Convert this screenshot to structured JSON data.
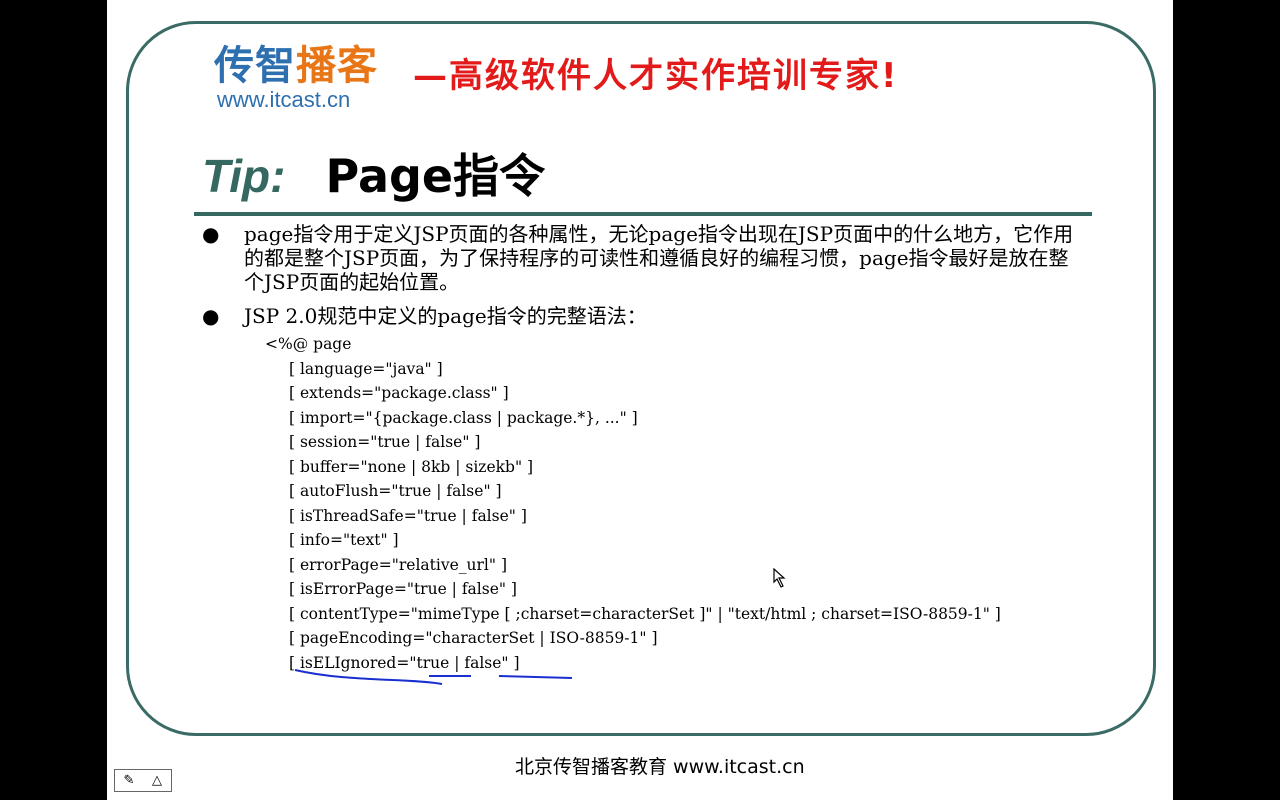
{
  "logo": {
    "name_part1": "传智",
    "name_part2": "播客",
    "url": "www.itcast.cn"
  },
  "slogan": "—高级软件人才实作培训专家!",
  "title": {
    "tip": "Tip:",
    "main": "Page指令"
  },
  "bullets": [
    "page指令用于定义JSP页面的各种属性，无论page指令出现在JSP页面中的什么地方，它作用的都是整个JSP页面，为了保持程序的可读性和遵循良好的编程习惯，page指令最好是放在整个JSP页面的起始位置。",
    "JSP 2.0规范中定义的page指令的完整语法："
  ],
  "code": {
    "open": "<%@ page",
    "lines": [
      "[ language=\"java\" ]",
      "[ extends=\"package.class\" ]",
      "[ import=\"{package.class | package.*}, ...\" ]",
      "[ session=\"true | false\" ]",
      "[ buffer=\"none | 8kb | sizekb\" ]",
      "[ autoFlush=\"true | false\" ]",
      "[ isThreadSafe=\"true | false\" ]",
      "[ info=\"text\" ]",
      "[ errorPage=\"relative_url\" ]",
      "[ isErrorPage=\"true | false\" ]",
      "[ contentType=\"mimeType [ ;charset=characterSet ]\" | \"text/html ; charset=ISO-8859-1\" ]",
      "[ pageEncoding=\"characterSet | ISO-8859-1\" ]",
      "[ isELIgnored=\"true | false\" ]"
    ]
  },
  "footer": "北京传智播客教育 www.itcast.cn",
  "colors": {
    "accent": "#356860",
    "logo_blue": "#2e6fb0",
    "logo_orange": "#e87617",
    "slogan_red": "#e31a1a",
    "annotation_blue": "#1a2fd0"
  },
  "icons": {
    "pen_cursor": "pen-cursor-icon",
    "nav_menu": "menu-icon",
    "nav_prev": "triangle-up-icon"
  }
}
